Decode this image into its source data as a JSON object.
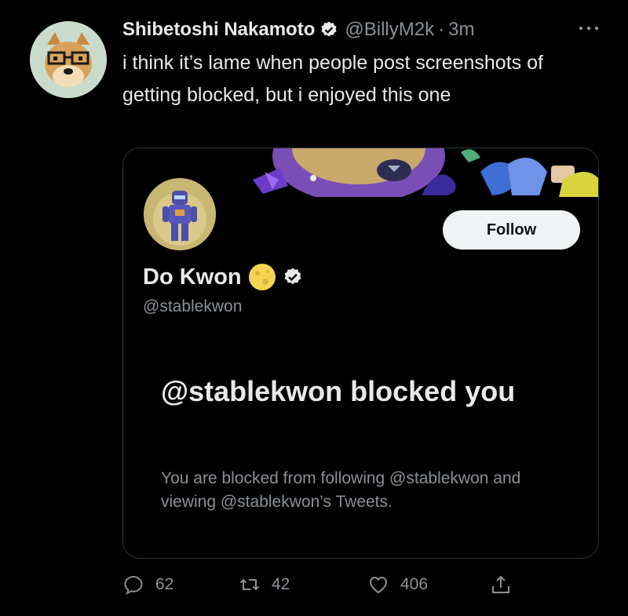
{
  "tweet": {
    "author_name": "Shibetoshi Nakamoto",
    "handle": "@BillyM2k",
    "separator": "·",
    "time": "3m",
    "more_icon": "ellipsis-icon",
    "text": "i think it’s lame when people post screenshots of getting blocked, but i enjoyed this one",
    "verified_icon": "verified-badge-icon",
    "avatar_icon": "doge-avatar"
  },
  "card": {
    "profile_name": "Do Kwon",
    "name_emoji": "moon-emoji-icon",
    "profile_handle": "@stablekwon",
    "follow_label": "Follow",
    "blocked_title": "@stablekwon blocked you",
    "blocked_description": "You are blocked from following @stablekwon and viewing @stablekwon’s Tweets."
  },
  "actions": {
    "reply_count": "62",
    "retweet_count": "42",
    "like_count": "406"
  },
  "colors": {
    "background": "#000000",
    "text_primary": "#e7e9ea",
    "text_secondary": "#8b9096",
    "border": "#2f3336",
    "follow_bg": "#eff3f4"
  }
}
